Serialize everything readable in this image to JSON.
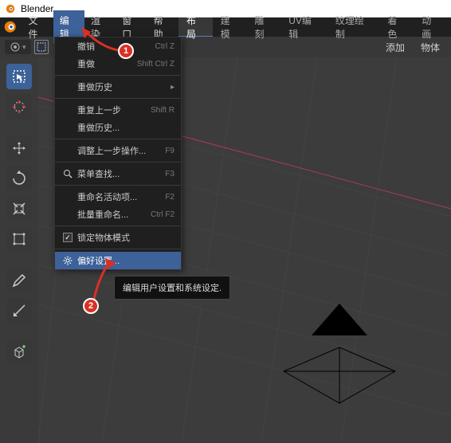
{
  "title": "Blender",
  "menubar": {
    "file": "文件",
    "edit": "编辑",
    "render": "渲染",
    "window": "窗口",
    "help": "帮助"
  },
  "workspaces": {
    "layout": "布局",
    "modeling": "建模",
    "sculpt": "雕刻",
    "uvedit": "UV编辑",
    "texpaint": "纹理绘制",
    "shading": "着色",
    "animation": "动画"
  },
  "subheader": {
    "add": "添加",
    "object": "物体"
  },
  "dropdown": {
    "undo": {
      "label": "撤销",
      "shortcut": "Ctrl Z"
    },
    "redo": {
      "label": "重做",
      "shortcut": "Shift Ctrl Z"
    },
    "undo_history": {
      "label": "重做历史"
    },
    "repeat_last": {
      "label": "重复上一步",
      "shortcut": "Shift R"
    },
    "repeat_history": {
      "label": "重做历史..."
    },
    "adjust_last": {
      "label": "调整上一步操作...",
      "shortcut": "F9"
    },
    "menu_search": {
      "label": "菜单查找...",
      "shortcut": "F3"
    },
    "rename_active": {
      "label": "重命名活动项...",
      "shortcut": "F2"
    },
    "batch_rename": {
      "label": "批量重命名...",
      "shortcut": "Ctrl F2"
    },
    "lock_object_mode": {
      "label": "锁定物体模式"
    },
    "preferences": {
      "label": "偏好设置..."
    }
  },
  "tooltip": "编辑用户设置和系统设定.",
  "annotations": {
    "step1": "1",
    "step2": "2"
  },
  "colors": {
    "accent": "#3d6199",
    "marker": "#d93025",
    "magenta": "#aa3a5a"
  }
}
